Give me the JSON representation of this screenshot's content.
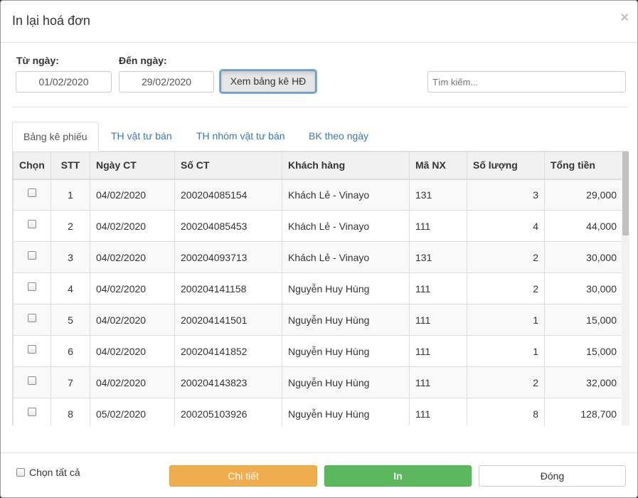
{
  "modal": {
    "title": "In lại hoá đơn",
    "close_glyph": "×"
  },
  "filters": {
    "from_label": "Từ ngày:",
    "from_value": "01/02/2020",
    "to_label": "Đến ngày:",
    "to_value": "29/02/2020",
    "view_button": "Xem bảng kê HĐ",
    "search_placeholder": "Tìm kiếm..."
  },
  "tabs": [
    "Bảng kê phiếu",
    "TH vật tư bán",
    "TH nhóm vật tư bán",
    "BK theo ngày"
  ],
  "table": {
    "headers": [
      "Chọn",
      "STT",
      "Ngày CT",
      "Số CT",
      "Khách hàng",
      "Mã NX",
      "Số lượng",
      "Tổng tiền"
    ],
    "rows": [
      {
        "stt": "1",
        "date": "04/02/2020",
        "so_ct": "200204085154",
        "customer": "Khách Lẻ - Vinayo",
        "ma_nx": "131",
        "qty": "3",
        "total": "29,000"
      },
      {
        "stt": "2",
        "date": "04/02/2020",
        "so_ct": "200204085453",
        "customer": "Khách Lẻ - Vinayo",
        "ma_nx": "111",
        "qty": "4",
        "total": "44,000"
      },
      {
        "stt": "3",
        "date": "04/02/2020",
        "so_ct": "200204093713",
        "customer": "Khách Lẻ - Vinayo",
        "ma_nx": "131",
        "qty": "2",
        "total": "30,000"
      },
      {
        "stt": "4",
        "date": "04/02/2020",
        "so_ct": "200204141158",
        "customer": "Nguyễn Huy Hùng",
        "ma_nx": "111",
        "qty": "2",
        "total": "30,000"
      },
      {
        "stt": "5",
        "date": "04/02/2020",
        "so_ct": "200204141501",
        "customer": "Nguyễn Huy Hùng",
        "ma_nx": "111",
        "qty": "1",
        "total": "15,000"
      },
      {
        "stt": "6",
        "date": "04/02/2020",
        "so_ct": "200204141852",
        "customer": "Nguyễn Huy Hùng",
        "ma_nx": "111",
        "qty": "1",
        "total": "15,000"
      },
      {
        "stt": "7",
        "date": "04/02/2020",
        "so_ct": "200204143823",
        "customer": "Nguyễn Huy Hùng",
        "ma_nx": "111",
        "qty": "2",
        "total": "32,000"
      },
      {
        "stt": "8",
        "date": "05/02/2020",
        "so_ct": "200205103926",
        "customer": "Nguyễn Huy Hùng",
        "ma_nx": "111",
        "qty": "8",
        "total": "128,700"
      }
    ]
  },
  "footer": {
    "select_all_label": "Chọn tất cả",
    "detail_button": "Chi tiết",
    "print_button": "In",
    "close_button": "Đóng"
  },
  "colors": {
    "detail": "#f0ad4e",
    "print": "#5cb85c",
    "link": "#337ab7"
  }
}
